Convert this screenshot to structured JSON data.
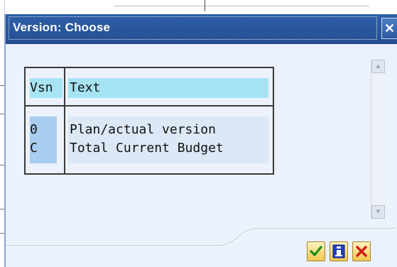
{
  "dialog": {
    "title": "Version: Choose",
    "close_glyph": "✕"
  },
  "list": {
    "columns": [
      "Vsn",
      "Text"
    ],
    "rows": [
      {
        "key": "0",
        "text": "Plan/actual version"
      },
      {
        "key": "C",
        "text": "Total Current Budget"
      }
    ]
  },
  "scrollbar": {
    "up_glyph": "▲",
    "down_glyph": "▼"
  },
  "buttons": [
    {
      "name": "continue",
      "icon": "check-icon"
    },
    {
      "name": "information",
      "icon": "info-icon"
    },
    {
      "name": "cancel",
      "icon": "cancel-x-icon"
    }
  ],
  "colors": {
    "title_bar": "#2a58a0",
    "header_highlight": "#a6e4f4",
    "key_highlight": "#a9cdf0",
    "button_yellow": "#f2c84c"
  }
}
